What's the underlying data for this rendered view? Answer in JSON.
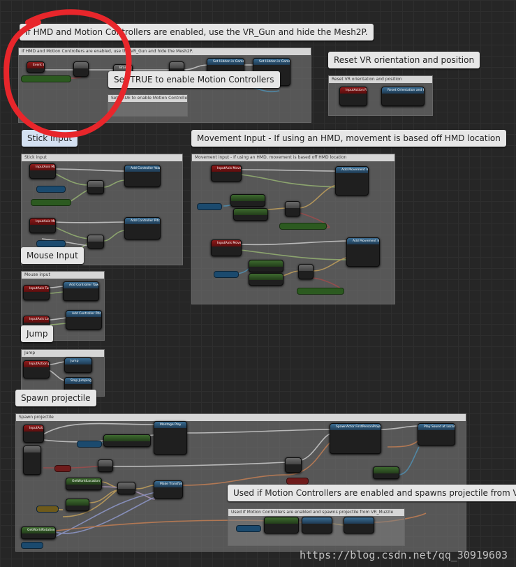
{
  "bubbles": {
    "hmd": "If HMD and Motion Controllers are enabled, use the VR_Gun and hide the Mesh2P.",
    "reset_vr": "Reset VR orientation and position",
    "stick_input": "Stick Input",
    "movement_input": "Movement Input - If using an HMD, movement is based off HMD location",
    "set_true": "Set TRUE to enable Motion Controllers",
    "mouse_input": "Mouse Input",
    "jump": "Jump",
    "spawn_projectile": "Spawn projectile",
    "motion_controllers": "Used if Motion Controllers are enabled and spawns projectile from VR_M"
  },
  "comment_headers": {
    "hmd": "If HMD and Motion Controllers are enabled, use the VR_Gun and hide the Mesh2P.",
    "reset_vr": "Reset VR orientation and position",
    "stick": "Stick input",
    "movement": "Movement input - If using an HMD, movement is based off HMD location",
    "set_true": "Set TRUE to enable Motion Controllers",
    "mouse": "Mouse input",
    "jump": "Jump",
    "spawn": "Spawn projectile",
    "mc": "Used if Motion Controllers are enabled and spawns projectile from VR_Muzzle"
  },
  "nodes": {
    "begin_play": "Event BeginPlay",
    "branch": "Branch",
    "set_hidden_1": "Set Hidden in Game",
    "set_hidden_2": "Set Hidden in Game",
    "reset_event": "InputAction ResetVR",
    "reset_fn": "Reset Orientation and Position",
    "move_forward": "InputAxis MoveForward",
    "move_right": "InputAxis MoveRight",
    "add_ctrl_yaw": "Add Controller Yaw Input",
    "add_ctrl_pitch": "Add Controller Pitch Input",
    "add_move_1": "Add Movement Input",
    "add_move_2": "Add Movement Input",
    "turn": "InputAxis Turn",
    "lookup": "InputAxis LookUp",
    "jump_event": "InputAction Jump",
    "jump_fn": "Jump",
    "stop_jump_fn": "Stop Jumping",
    "fire": "InputAction Fire",
    "montage_play": "Montage Play",
    "spawn_actor": "SpawnActor FirstPersonProjectile",
    "play_sound": "Play Sound at Location",
    "make_transform": "Make Transform",
    "get_world_location": "GetWorldLocation",
    "get_world_rotation": "GetWorldRotation",
    "is_hmd": "Is Head Mounted Display Enabled"
  },
  "watermark": "https://blog.csdn.net/qq_30919603"
}
